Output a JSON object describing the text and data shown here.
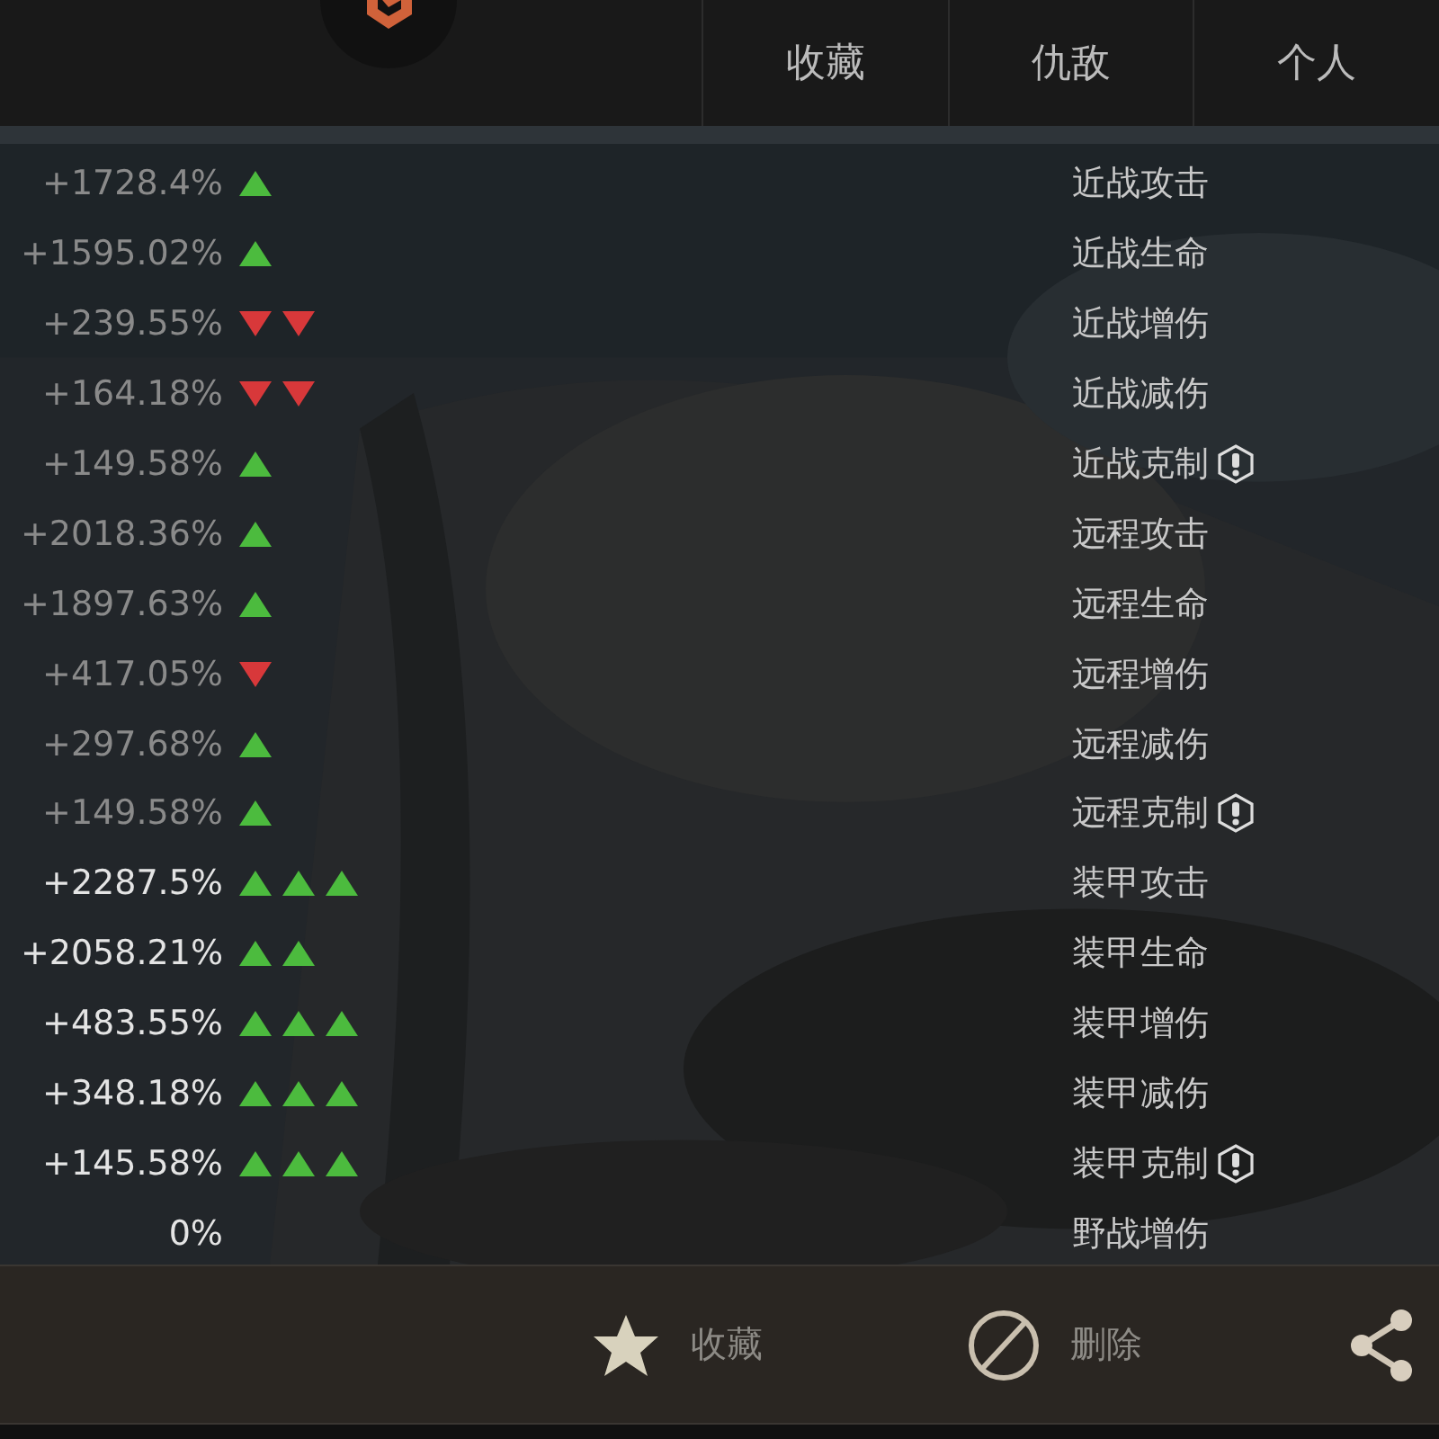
{
  "tabs": [
    {
      "label": "收藏"
    },
    {
      "label": "仇敌"
    },
    {
      "label": "个人"
    }
  ],
  "rows": [
    {
      "value": "+1728.4%",
      "bright": false,
      "arrows": [
        {
          "kind": "up"
        }
      ],
      "label": "近战攻击",
      "warning": false
    },
    {
      "value": "+1595.02%",
      "bright": false,
      "arrows": [
        {
          "kind": "up"
        }
      ],
      "label": "近战生命",
      "warning": false
    },
    {
      "value": "+239.55%",
      "bright": false,
      "arrows": [
        {
          "kind": "down"
        },
        {
          "kind": "down"
        }
      ],
      "label": "近战增伤",
      "warning": false
    },
    {
      "value": "+164.18%",
      "bright": false,
      "arrows": [
        {
          "kind": "down"
        },
        {
          "kind": "down"
        }
      ],
      "label": "近战减伤",
      "warning": false
    },
    {
      "value": "+149.58%",
      "bright": false,
      "arrows": [
        {
          "kind": "up"
        }
      ],
      "label": "近战克制",
      "warning": true
    },
    {
      "value": "+2018.36%",
      "bright": false,
      "arrows": [
        {
          "kind": "up"
        }
      ],
      "label": "远程攻击",
      "warning": false
    },
    {
      "value": "+1897.63%",
      "bright": false,
      "arrows": [
        {
          "kind": "up"
        }
      ],
      "label": "远程生命",
      "warning": false
    },
    {
      "value": "+417.05%",
      "bright": false,
      "arrows": [
        {
          "kind": "down"
        }
      ],
      "label": "远程增伤",
      "warning": false
    },
    {
      "value": "+297.68%",
      "bright": false,
      "arrows": [
        {
          "kind": "up"
        }
      ],
      "label": "远程减伤",
      "warning": false
    },
    {
      "value": "+149.58%",
      "bright": false,
      "arrows": [
        {
          "kind": "up"
        }
      ],
      "label": "远程克制",
      "warning": true
    },
    {
      "value": "+2287.5%",
      "bright": true,
      "arrows": [
        {
          "kind": "up"
        },
        {
          "kind": "up"
        },
        {
          "kind": "up"
        }
      ],
      "label": "装甲攻击",
      "warning": false
    },
    {
      "value": "+2058.21%",
      "bright": true,
      "arrows": [
        {
          "kind": "up"
        },
        {
          "kind": "up"
        }
      ],
      "label": "装甲生命",
      "warning": false
    },
    {
      "value": "+483.55%",
      "bright": true,
      "arrows": [
        {
          "kind": "up"
        },
        {
          "kind": "up"
        },
        {
          "kind": "up"
        }
      ],
      "label": "装甲增伤",
      "warning": false
    },
    {
      "value": "+348.18%",
      "bright": true,
      "arrows": [
        {
          "kind": "up"
        },
        {
          "kind": "up"
        },
        {
          "kind": "up"
        }
      ],
      "label": "装甲减伤",
      "warning": false
    },
    {
      "value": "+145.58%",
      "bright": true,
      "arrows": [
        {
          "kind": "up"
        },
        {
          "kind": "up"
        },
        {
          "kind": "up"
        }
      ],
      "label": "装甲克制",
      "warning": true
    },
    {
      "value": "0%",
      "bright": true,
      "label": "野战增伤",
      "warning": false
    }
  ],
  "footer": [
    {
      "kind": "favorite",
      "label": "收藏"
    },
    {
      "kind": "delete",
      "label": "删除"
    },
    {
      "kind": "share"
    }
  ]
}
